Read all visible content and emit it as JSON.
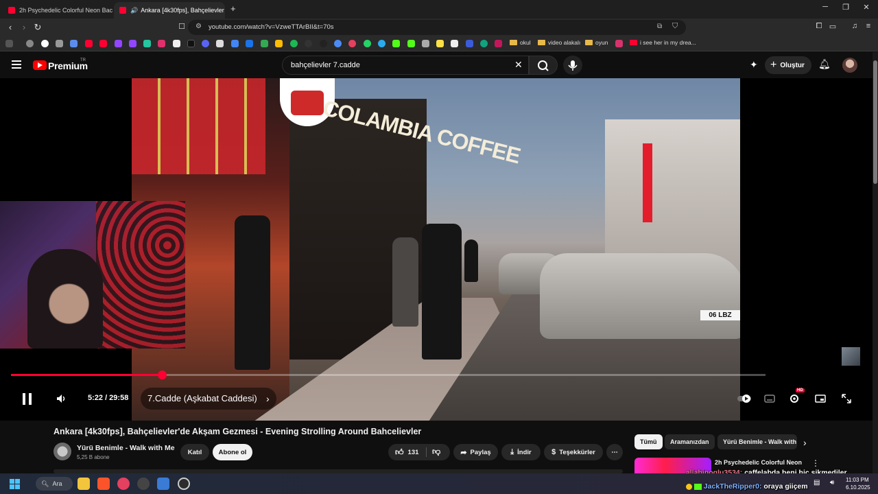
{
  "browser": {
    "tabs": [
      {
        "title": "2h Psychedelic Colorful Neon Backgr",
        "active": false
      },
      {
        "title": "Ankara [4k30fps], Bahçelievler",
        "active": true
      }
    ],
    "new_tab": "+",
    "url": "youtube.com/watch?v=VzweTTArBII&t=70s",
    "bookmark_folders": [
      "okul",
      "video alakalı",
      "oyun"
    ],
    "bookmark_link": "i see her in my drea..."
  },
  "youtube": {
    "brand": "Premium",
    "region": "TR",
    "search_value": "bahçelievler 7.cadde",
    "create_label": "Oluştur"
  },
  "player": {
    "time": "5:22 / 29:58",
    "progress_fraction": 0.2,
    "chapter": "7.Cadde (Aşkabat Caddesi)",
    "hd_badge": "HD",
    "plate": "06 LBZ",
    "sign_text": "COLAMBIA COFFEE"
  },
  "video": {
    "title": "Ankara [4k30fps], Bahçelievler'de Akşam Gezmesi - Evening Strolling Around Bahcelievler",
    "channel": "Yürü Benimle - Walk with Me",
    "subscribers": "5,25 B abone",
    "join_label": "Katıl",
    "subscribe_label": "Abone ol",
    "likes": "131",
    "share_label": "Paylaş",
    "download_label": "İndir",
    "thanks_label": "Teşekkürler"
  },
  "recommendations": {
    "chips": [
      "Tümü",
      "Aramanızdan",
      "Yürü Benimle - Walk with"
    ],
    "first_title": "2h Psychedelic Colorful Neon"
  },
  "chat": [
    {
      "user": "allahinoglu3534:",
      "message": "caffelabda beni hic sikmediler"
    },
    {
      "user": "JackTheRipper0:",
      "message": "oraya giiçem"
    }
  ],
  "taskbar": {
    "search_label": "Ara",
    "time": "11:03 PM",
    "date": "6.10.2025"
  },
  "colors": {
    "accent": "#ff0033",
    "background": "#0f0f0f",
    "pill": "#272727"
  }
}
